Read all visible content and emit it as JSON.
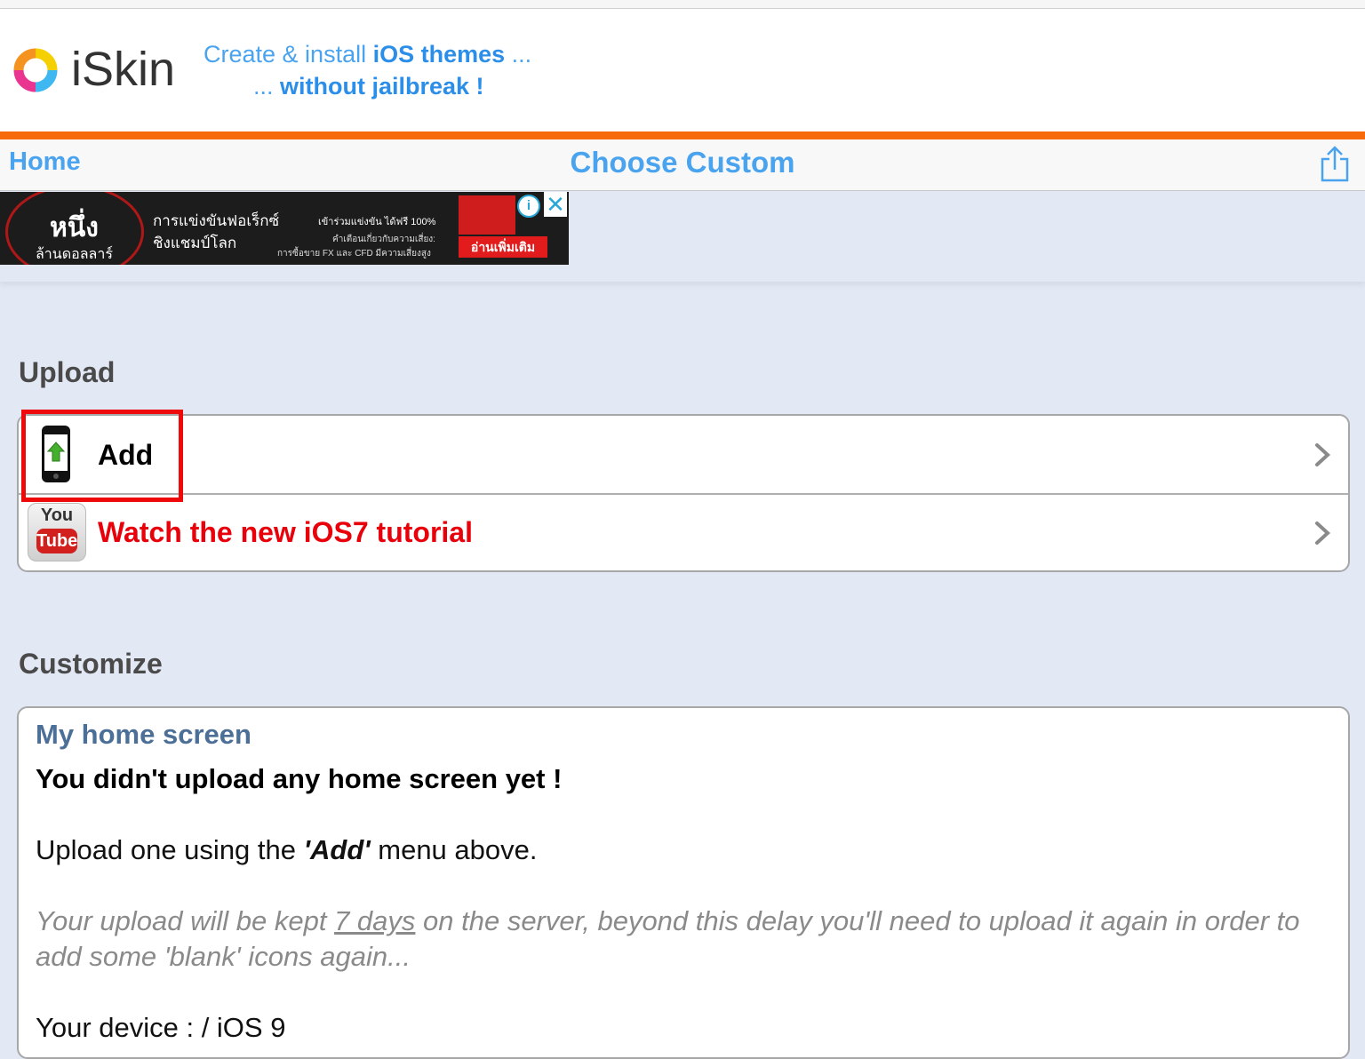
{
  "header": {
    "app_name": "iSkin",
    "tagline_1_pre": "Create & install ",
    "tagline_1_bold": "iOS themes",
    "tagline_1_post": " ...",
    "tagline_2_pre": "... ",
    "tagline_2_bold": "without jailbreak !"
  },
  "nav": {
    "home": "Home",
    "title": "Choose Custom"
  },
  "ad": {
    "big": "หนึ่ง",
    "big_sub": "ล้านดอลลาร์",
    "line1": "การแข่งขันฟอเร็กซ์",
    "line2": "ชิงแชมป์โลก",
    "line3": "เข้าร่วมแข่งขัน ได้ฟรี 100%",
    "line4": "คำเตือนเกี่ยวกับความเสี่ยง:",
    "line5": "การซื้อขาย FX และ CFD มีความเสี่ยงสูง",
    "button": "อ่านเพิ่มเติม",
    "info": "i",
    "close": "✕"
  },
  "upload": {
    "section_title": "Upload",
    "items": [
      {
        "label": "Add",
        "icon": "phone-upload-icon"
      },
      {
        "label": "Watch the new iOS7 tutorial",
        "icon": "youtube-icon"
      }
    ],
    "youtube_top": "You",
    "youtube_bottom": "Tube"
  },
  "customize": {
    "section_title": "Customize",
    "card_title": "My home screen",
    "empty_message": "You didn't upload any home screen yet !",
    "instruction_pre": "Upload one using the ",
    "instruction_emph": "'Add'",
    "instruction_post": " menu above.",
    "note_pre": "Your upload will be kept ",
    "note_link": "7 days",
    "note_post": " on the server, beyond this delay you'll need to upload it again in order to add some 'blank' icons again...",
    "device": "Your device : / iOS 9"
  },
  "colors": {
    "accent_blue": "#4aa3ee",
    "orange_bar": "#f66a0a",
    "highlight_red": "#ee0a0a",
    "tutorial_red": "#e8000b",
    "page_bg": "#e3e8f5"
  }
}
